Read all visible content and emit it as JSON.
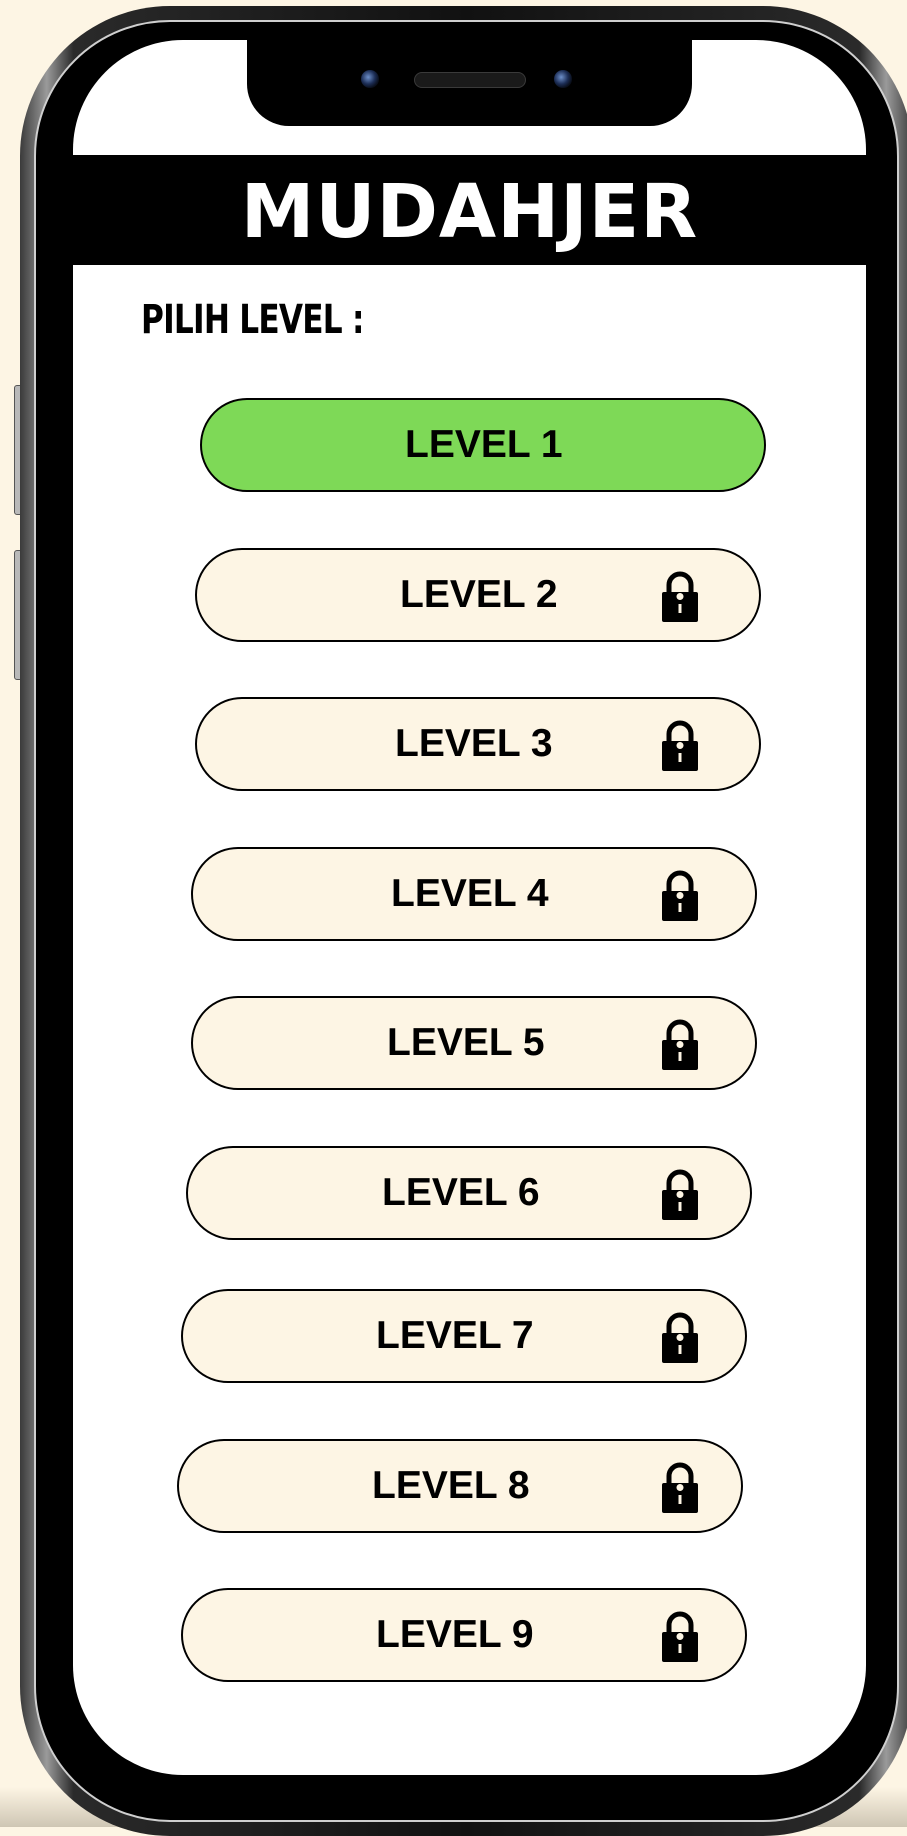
{
  "app": {
    "title": "MUDAHJER",
    "subtitle": "PILIH LEVEL :"
  },
  "levels": [
    {
      "label": "LEVEL 1",
      "locked": false
    },
    {
      "label": "LEVEL 2",
      "locked": true
    },
    {
      "label": "LEVEL 3",
      "locked": true
    },
    {
      "label": "LEVEL 4",
      "locked": true
    },
    {
      "label": "LEVEL 5",
      "locked": true
    },
    {
      "label": "LEVEL 6",
      "locked": true
    },
    {
      "label": "LEVEL 7",
      "locked": true
    },
    {
      "label": "LEVEL 8",
      "locked": true
    },
    {
      "label": "LEVEL 9",
      "locked": true
    }
  ],
  "icons": {
    "locked": "lock-icon"
  },
  "colors": {
    "background": "#fdf5e4",
    "title_bar": "#000000",
    "unlocked_button": "#7ed957",
    "locked_button": "#fdf5e4",
    "text": "#000000"
  }
}
